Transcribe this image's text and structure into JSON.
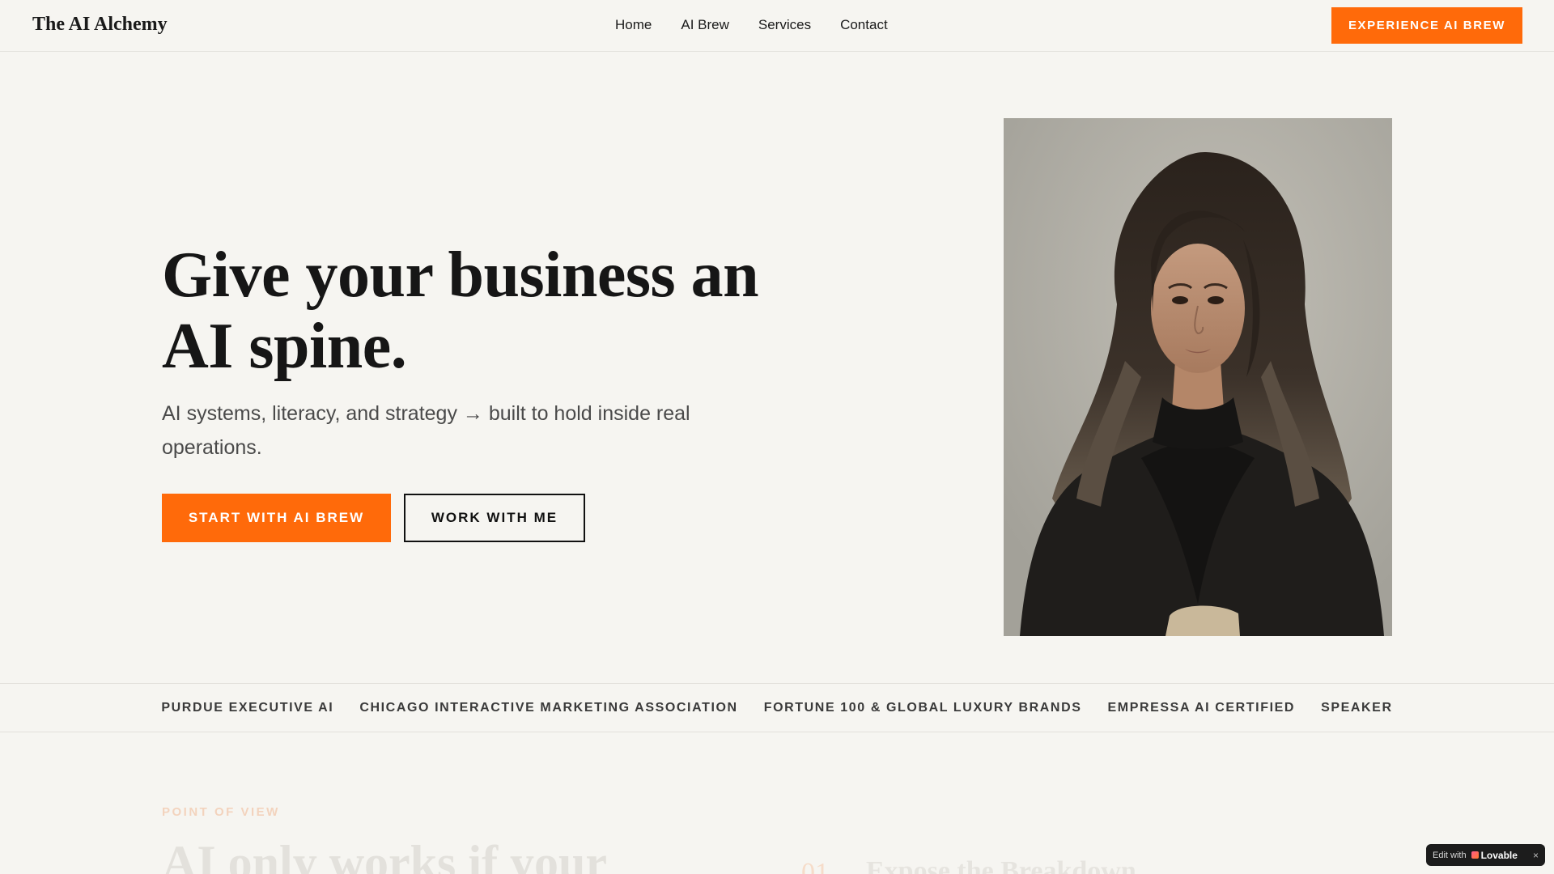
{
  "header": {
    "logo": "The AI Alchemy",
    "nav": [
      "Home",
      "AI Brew",
      "Services",
      "Contact"
    ],
    "cta": "EXPERIENCE AI BREW"
  },
  "hero": {
    "title": "Give your business an AI spine.",
    "subtitle": "AI systems, literacy, and strategy → built to hold inside real operations.",
    "primary_cta": "START WITH AI BREW",
    "secondary_cta": "WORK WITH ME"
  },
  "credentials": [
    "PURDUE EXECUTIVE AI",
    "CHICAGO INTERACTIVE MARKETING ASSOCIATION",
    "FORTUNE 100 & GLOBAL LUXURY BRANDS",
    "EMPRESSA AI CERTIFIED",
    "SPEAKER"
  ],
  "pov": {
    "label": "POINT OF VIEW",
    "title": "AI only works if your",
    "item_number": "01",
    "item_title": "Expose the Breakdown"
  },
  "badge": {
    "prefix": "Edit with",
    "brand": "Lovable",
    "close": "×"
  },
  "colors": {
    "accent": "#ff6a0a",
    "background": "#f6f5f1",
    "text": "#1a1a1a"
  }
}
